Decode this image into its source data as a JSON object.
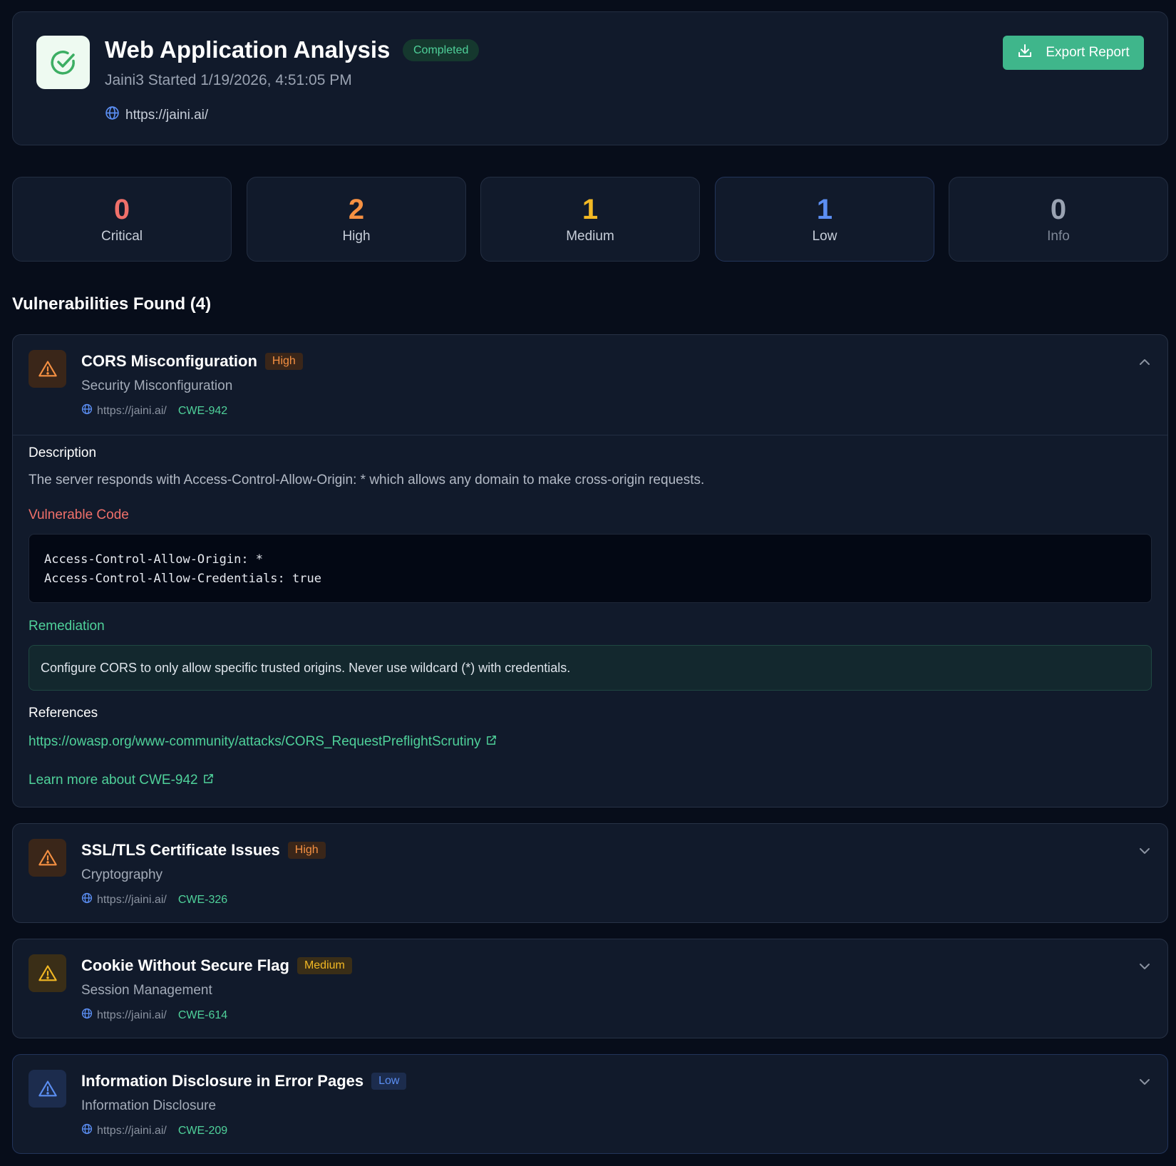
{
  "header": {
    "title": "Web Application Analysis",
    "status": "Completed",
    "subtitle": "Jaini3 Started 1/19/2026, 4:51:05 PM",
    "target_url": "https://jaini.ai/",
    "export_label": "Export Report"
  },
  "stats": [
    {
      "value": "0",
      "label": "Critical",
      "color": "#f0706a"
    },
    {
      "value": "2",
      "label": "High",
      "color": "#f59042"
    },
    {
      "value": "1",
      "label": "Medium",
      "color": "#f2b824"
    },
    {
      "value": "1",
      "label": "Low",
      "color": "#5b8ef2"
    },
    {
      "value": "0",
      "label": "Info",
      "color": "#9aa3b2"
    }
  ],
  "section_title": "Vulnerabilities Found (4)",
  "vulnerabilities": [
    {
      "title": "CORS Misconfiguration",
      "severity": "High",
      "category": "Security Misconfiguration",
      "url": "https://jaini.ai/",
      "cwe": "CWE-942",
      "expanded": true,
      "detail": {
        "description_label": "Description",
        "description": "The server responds with Access-Control-Allow-Origin: * which allows any domain to make cross-origin requests.",
        "code_label": "Vulnerable Code",
        "code": "Access-Control-Allow-Origin: *\nAccess-Control-Allow-Credentials: true",
        "remediation_label": "Remediation",
        "remediation": "Configure CORS to only allow specific trusted origins. Never use wildcard (*) with credentials.",
        "references_label": "References",
        "reference_url": "https://owasp.org/www-community/attacks/CORS_RequestPreflightScrutiny",
        "learn_more": "Learn more about CWE-942"
      }
    },
    {
      "title": "SSL/TLS Certificate Issues",
      "severity": "High",
      "category": "Cryptography",
      "url": "https://jaini.ai/",
      "cwe": "CWE-326",
      "expanded": false
    },
    {
      "title": "Cookie Without Secure Flag",
      "severity": "Medium",
      "category": "Session Management",
      "url": "https://jaini.ai/",
      "cwe": "CWE-614",
      "expanded": false
    },
    {
      "title": "Information Disclosure in Error Pages",
      "severity": "Low",
      "category": "Information Disclosure",
      "url": "https://jaini.ai/",
      "cwe": "CWE-209",
      "expanded": false
    }
  ],
  "colors": {
    "accent": "#3fb68b",
    "high_text": "#f59042",
    "high_bg": "#3a2619",
    "medium_text": "#f2b824",
    "medium_bg": "#3a2e17",
    "low_text": "#5b8ef2",
    "low_bg": "#1c2c4d",
    "vuln_code_label": "#f0706a",
    "remediation_label": "#4fd19a"
  }
}
